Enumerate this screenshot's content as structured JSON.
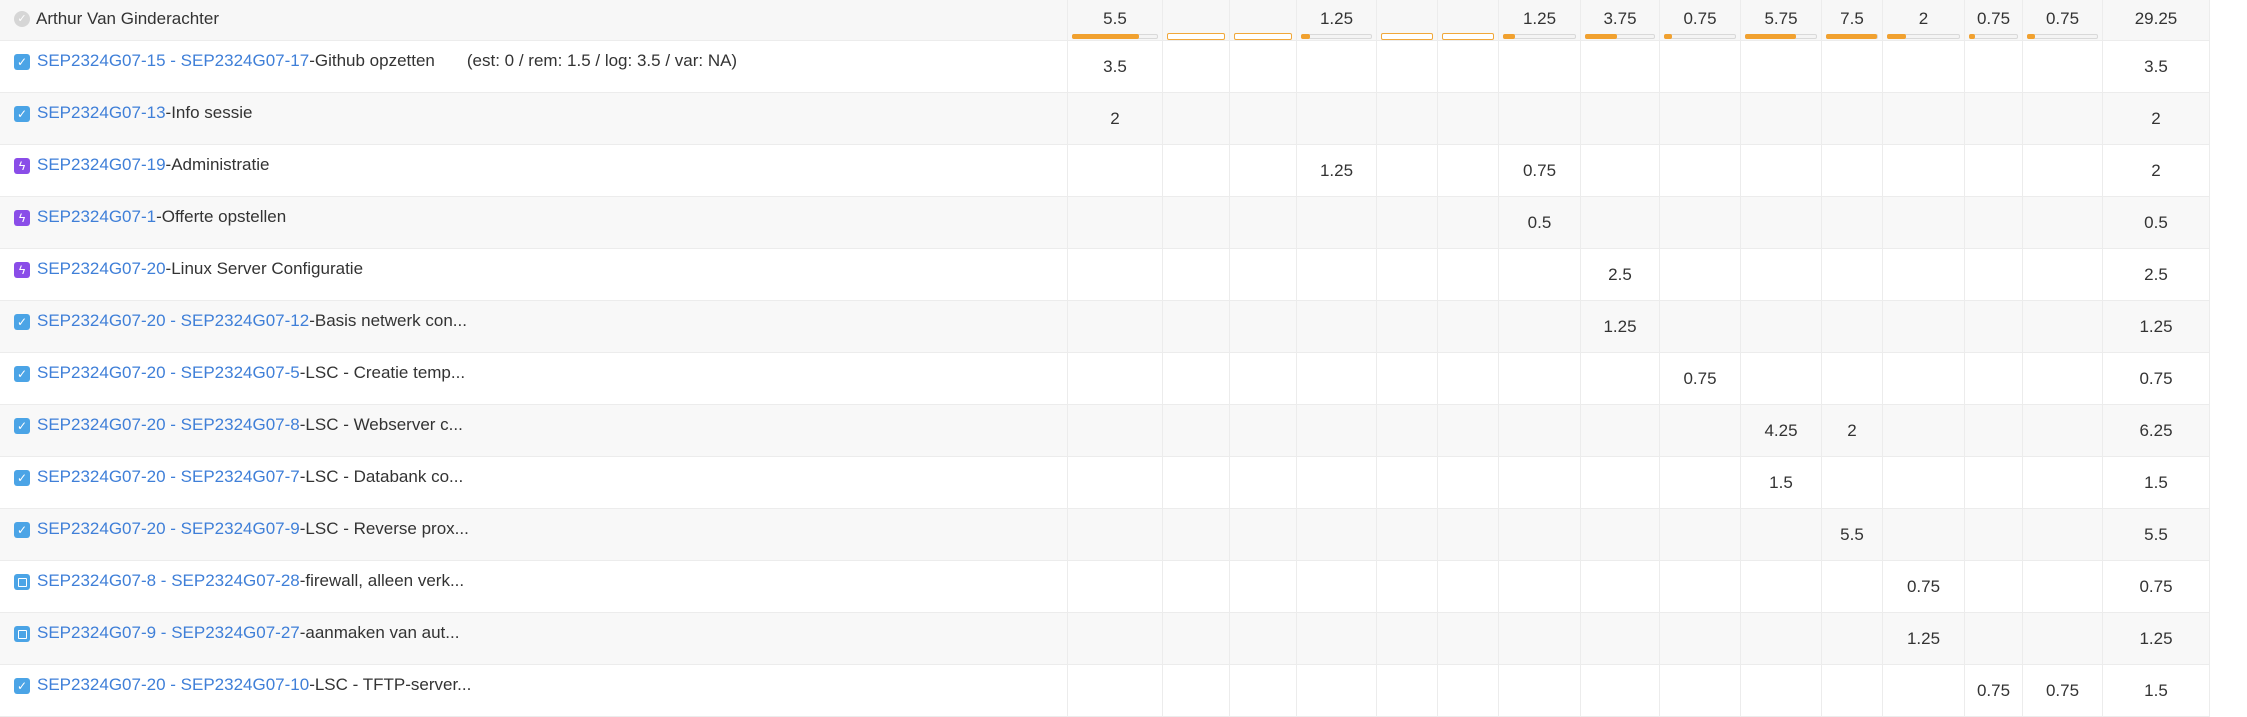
{
  "user": {
    "name": "Arthur Van Ginderachter",
    "check_glyph": "✓"
  },
  "header_values": [
    "5.5",
    "",
    "",
    "1.25",
    "",
    "",
    "1.25",
    "3.75",
    "0.75",
    "5.75",
    "7.5",
    "2",
    "0.75",
    "0.75",
    "29.25"
  ],
  "header_bars": [
    {
      "filled": 0.78,
      "empty": false
    },
    {
      "filled": 0,
      "empty": true
    },
    {
      "filled": 0,
      "empty": true
    },
    {
      "filled": 0.12,
      "empty": false
    },
    {
      "filled": 0,
      "empty": true
    },
    {
      "filled": 0,
      "empty": true
    },
    {
      "filled": 0.15,
      "empty": false
    },
    {
      "filled": 0.45,
      "empty": false
    },
    {
      "filled": 0.1,
      "empty": false
    },
    {
      "filled": 0.72,
      "empty": false
    },
    {
      "filled": 1.0,
      "empty": false
    },
    {
      "filled": 0.25,
      "empty": false
    },
    {
      "filled": 0.1,
      "empty": false
    },
    {
      "filled": 0.1,
      "empty": false
    },
    {
      "filled": 0,
      "empty": false
    }
  ],
  "rows": [
    {
      "type": "task",
      "key": "SEP2324G07-15 - SEP2324G07-17",
      "summary": " -Github opzetten",
      "est": "(est: 0 / rem: 1.5 / log: 3.5 / var: NA)",
      "values": [
        "3.5",
        "",
        "",
        "",
        "",
        "",
        "",
        "",
        "",
        "",
        "",
        "",
        "",
        "",
        ""
      ],
      "total": "3.5"
    },
    {
      "type": "task",
      "key": "SEP2324G07-13",
      "summary": " -Info sessie",
      "est": "",
      "values": [
        "2",
        "",
        "",
        "",
        "",
        "",
        "",
        "",
        "",
        "",
        "",
        "",
        "",
        "",
        ""
      ],
      "total": "2"
    },
    {
      "type": "epic",
      "key": "SEP2324G07-19",
      "summary": " -Administratie",
      "est": "",
      "values": [
        "",
        "",
        "",
        "1.25",
        "",
        "",
        "0.75",
        "",
        "",
        "",
        "",
        "",
        "",
        "",
        ""
      ],
      "total": "2"
    },
    {
      "type": "epic",
      "key": "SEP2324G07-1",
      "summary": " -Offerte opstellen",
      "est": "",
      "values": [
        "",
        "",
        "",
        "",
        "",
        "",
        "0.5",
        "",
        "",
        "",
        "",
        "",
        "",
        "",
        ""
      ],
      "total": "0.5"
    },
    {
      "type": "epic",
      "key": "SEP2324G07-20",
      "summary": " -Linux Server Configuratie",
      "est": "",
      "values": [
        "",
        "",
        "",
        "",
        "",
        "",
        "",
        "2.5",
        "",
        "",
        "",
        "",
        "",
        "",
        ""
      ],
      "total": "2.5"
    },
    {
      "type": "task",
      "key": "SEP2324G07-20 - SEP2324G07-12",
      "summary": " -Basis netwerk con...",
      "est": "",
      "values": [
        "",
        "",
        "",
        "",
        "",
        "",
        "",
        "1.25",
        "",
        "",
        "",
        "",
        "",
        "",
        ""
      ],
      "total": "1.25"
    },
    {
      "type": "task",
      "key": "SEP2324G07-20 - SEP2324G07-5",
      "summary": " -LSC - Creatie temp...",
      "est": "",
      "values": [
        "",
        "",
        "",
        "",
        "",
        "",
        "",
        "",
        "0.75",
        "",
        "",
        "",
        "",
        "",
        ""
      ],
      "total": "0.75"
    },
    {
      "type": "task",
      "key": "SEP2324G07-20 - SEP2324G07-8",
      "summary": " -LSC - Webserver c...",
      "est": "",
      "values": [
        "",
        "",
        "",
        "",
        "",
        "",
        "",
        "",
        "",
        "4.25",
        "2",
        "",
        "",
        "",
        ""
      ],
      "total": "6.25"
    },
    {
      "type": "task",
      "key": "SEP2324G07-20 - SEP2324G07-7",
      "summary": " -LSC - Databank co...",
      "est": "",
      "values": [
        "",
        "",
        "",
        "",
        "",
        "",
        "",
        "",
        "",
        "1.5",
        "",
        "",
        "",
        "",
        ""
      ],
      "total": "1.5"
    },
    {
      "type": "task",
      "key": "SEP2324G07-20 - SEP2324G07-9",
      "summary": " -LSC - Reverse prox...",
      "est": "",
      "values": [
        "",
        "",
        "",
        "",
        "",
        "",
        "",
        "",
        "",
        "",
        "5.5",
        "",
        "",
        "",
        ""
      ],
      "total": "5.5"
    },
    {
      "type": "sub",
      "key": "SEP2324G07-8 - SEP2324G07-28",
      "summary": " -firewall, alleen verk...",
      "est": "",
      "values": [
        "",
        "",
        "",
        "",
        "",
        "",
        "",
        "",
        "",
        "",
        "",
        "0.75",
        "",
        "",
        ""
      ],
      "total": "0.75"
    },
    {
      "type": "sub",
      "key": "SEP2324G07-9 - SEP2324G07-27",
      "summary": " -aanmaken van aut...",
      "est": "",
      "values": [
        "",
        "",
        "",
        "",
        "",
        "",
        "",
        "",
        "",
        "",
        "",
        "1.25",
        "",
        "",
        ""
      ],
      "total": "1.25"
    },
    {
      "type": "task",
      "key": "SEP2324G07-20 - SEP2324G07-10",
      "summary": " -LSC - TFTP-server...",
      "est": "",
      "values": [
        "",
        "",
        "",
        "",
        "",
        "",
        "",
        "",
        "",
        "",
        "",
        "",
        "0.75",
        "0.75",
        ""
      ],
      "total": "1.5"
    }
  ],
  "icons": {
    "task": "checkbox-icon",
    "epic": "lightning-icon",
    "sub": "subtask-icon"
  },
  "colors": {
    "link": "#3f7fd8",
    "bar_fill": "#f1a12f",
    "task_icon": "#4ba4e6",
    "epic_icon": "#8a4de8"
  }
}
